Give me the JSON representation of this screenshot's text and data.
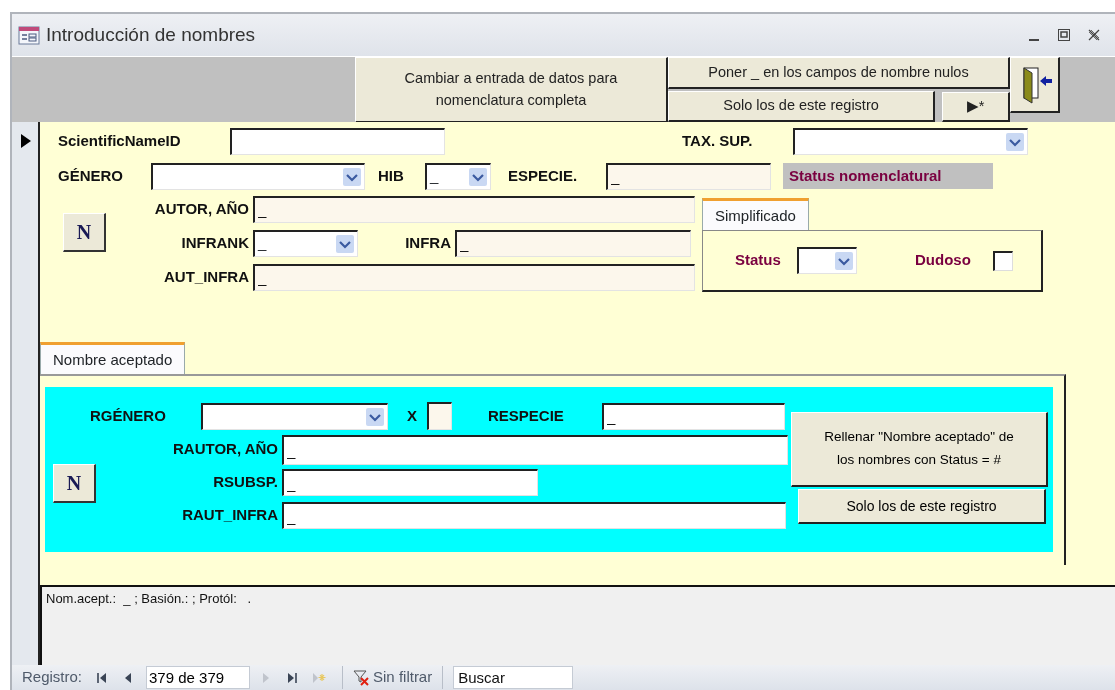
{
  "window": {
    "title": "Introducción de nombres"
  },
  "header": {
    "mode_button": "Cambiar a entrada de datos para nomenclatura completa",
    "fill_button": "Poner _ en los campos de nombre nulos",
    "record_button": "Solo los de este registro",
    "new_record_button": "▶*"
  },
  "record_selector": {
    "current": true
  },
  "main": {
    "scientific_name_id": {
      "label": "ScientificNameID",
      "kind": "text"
    },
    "tax_sup": {
      "label": "TAX. SUP.",
      "kind": "combo"
    },
    "genero": {
      "label": "GÉNERO",
      "kind": "combo"
    },
    "hib": {
      "label": "HIB",
      "kind": "combo",
      "value": "_"
    },
    "especie": {
      "label": "ESPECIE.",
      "kind": "text",
      "value": "_"
    },
    "status_heading": "Status nomenclatural",
    "n_button": "N",
    "autor": {
      "label": "AUTOR, AÑO",
      "kind": "text",
      "value": "_"
    },
    "infrank": {
      "label": "INFRANK",
      "kind": "combo",
      "value": "_"
    },
    "infra": {
      "label": "INFRA",
      "kind": "text",
      "value": "_"
    },
    "aut_infra": {
      "label": "AUT_INFRA",
      "kind": "text",
      "value": "_"
    }
  },
  "status_tabs": [
    {
      "label": "Simplificado",
      "selected": true
    }
  ],
  "status_panel": {
    "status": {
      "label": "Status",
      "kind": "combo"
    },
    "dudoso": {
      "label": "Dudoso",
      "checked": false
    }
  },
  "accepted_tabs": [
    {
      "label": "Nombre aceptado",
      "selected": true
    }
  ],
  "accepted": {
    "rgenero": {
      "label": "RGÉNERO",
      "kind": "combo"
    },
    "x": {
      "label": "X",
      "kind": "text"
    },
    "respecie": {
      "label": "RESPECIE",
      "kind": "text",
      "value": "_"
    },
    "rautor": {
      "label": "RAUTOR, AÑO",
      "kind": "text",
      "value": "_"
    },
    "n_button": "N",
    "rsubsp": {
      "label": "RSUBSP.",
      "kind": "text",
      "value": "_"
    },
    "raut_infra": {
      "label": "RAUT_INFRA",
      "kind": "text",
      "value": "_"
    },
    "fill_button": "Rellenar \"Nombre aceptado\" de los nombres con Status = #",
    "record_button": "Solo los de este registro"
  },
  "summary": "Nom.acept.:  _ ; Basión.: ; Protól:   .",
  "navigation": {
    "label": "Registro:",
    "position": "379 de 379",
    "buttons": [
      {
        "kind": "first",
        "disabled": false
      },
      {
        "kind": "previous",
        "disabled": false
      },
      {
        "kind": "next",
        "disabled": true
      },
      {
        "kind": "last",
        "disabled": false
      },
      {
        "kind": "new",
        "disabled": true
      }
    ],
    "filter": "Sin filtrar",
    "search_placeholder": "Buscar"
  }
}
